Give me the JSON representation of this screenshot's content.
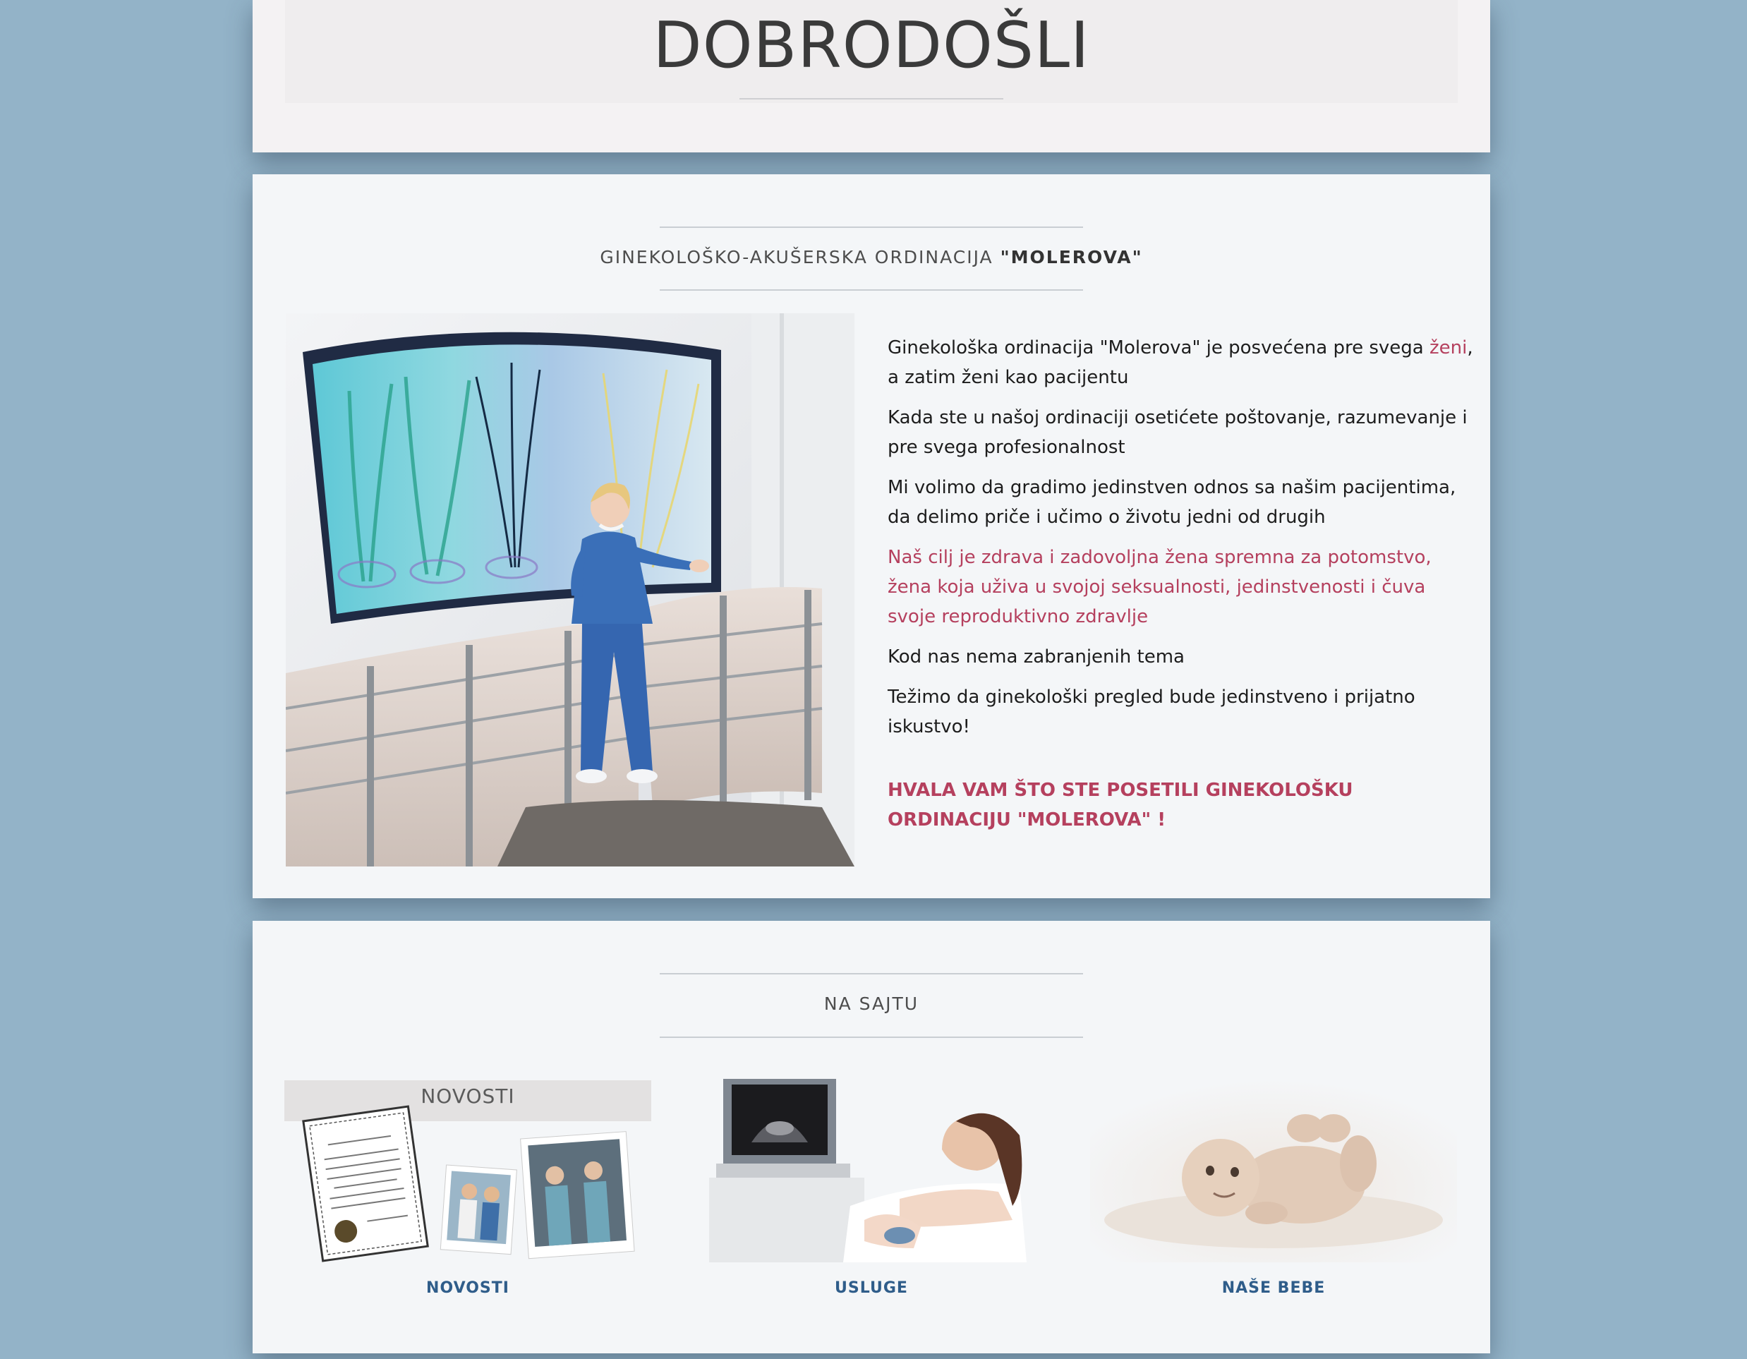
{
  "welcome": {
    "title": "DOBRODOŠLI"
  },
  "about": {
    "heading_prefix": "GINEKOLOŠKO-AKUŠERSKA ORDINACIJA ",
    "heading_name": "\"MOLEROVA\"",
    "p1_before": "Ginekološka ordinacija \"Molerova\" je posvećena pre svega ",
    "p1_link": "ženi",
    "p1_after": ", a zatim ženi kao pacijentu",
    "p2": "Kada ste u našoj ordinaciji osetićete poštovanje, razumevanje i pre svega profesionalnost",
    "p3": "Mi volimo da gradimo jedinstven odnos sa našim pacijentima, da delimo priče i učimo o životu jedni od drugih",
    "p4": "Naš cilj je zdrava i zadovoljna žena spremna za potomstvo, žena koja uživa u svojoj seksualnosti, jedinstvenosti i čuva svoje reproduktivno zdravlje",
    "p5": "Kod nas nema zabranjenih tema",
    "p6": "Težimo da ginekološki pregled bude jedinstveno i prijatno iskustvo!",
    "closing": "HVALA VAM ŠTO STE POSETILI GINEKOLOŠKU ORDINACIJU \"MOLEROVA\" !"
  },
  "site": {
    "heading": "NA SAJTU",
    "tiles": [
      {
        "banner": "NOVOSTI",
        "label": "NOVOSTI"
      },
      {
        "label": "USLUGE"
      },
      {
        "label": "NAŠE BEBE"
      }
    ]
  },
  "colors": {
    "background": "#93b3c8",
    "accent": "#b5405e",
    "link": "#2f5d8a"
  }
}
